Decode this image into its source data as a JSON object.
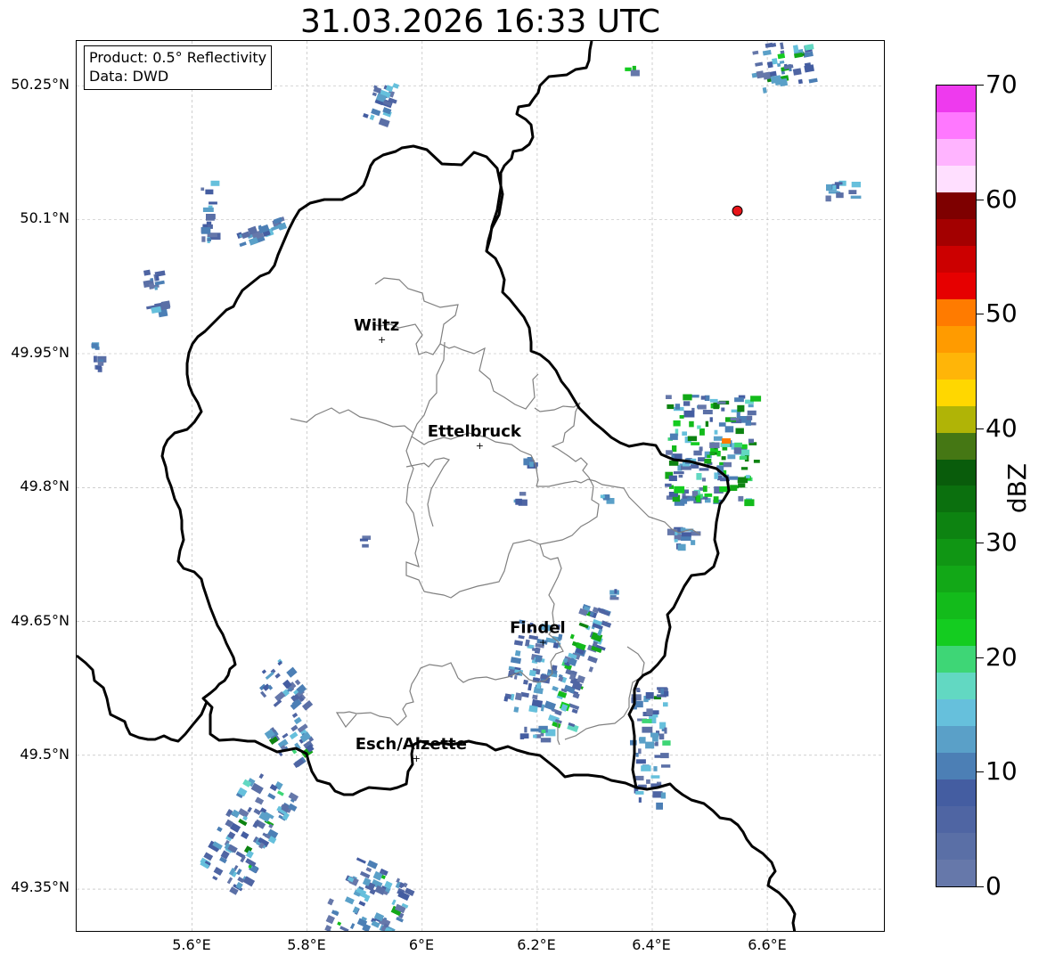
{
  "title": "31.03.2026 16:33 UTC",
  "info": {
    "product": "Product: 0.5° Reflectivity",
    "data": "Data: DWD"
  },
  "axes": {
    "lat_ticks": [
      "50.25°N",
      "50.1°N",
      "49.95°N",
      "49.8°N",
      "49.65°N",
      "49.5°N",
      "49.35°N"
    ],
    "lon_ticks": [
      "5.6°E",
      "5.8°E",
      "6°E",
      "6.2°E",
      "6.4°E",
      "6.6°E"
    ]
  },
  "cities": [
    {
      "name": "Wiltz",
      "lon": 5.93,
      "lat": 49.966
    },
    {
      "name": "Ettelbruck",
      "lon": 6.1,
      "lat": 49.847
    },
    {
      "name": "Findel",
      "lon": 6.21,
      "lat": 49.627
    },
    {
      "name": "Esch/Alzette",
      "lon": 5.99,
      "lat": 49.497
    }
  ],
  "radar_site": {
    "lon": 6.548,
    "lat": 50.11,
    "color": "#e8151a"
  },
  "colorbar": {
    "label": "dBZ",
    "tick_labels": [
      "0",
      "10",
      "20",
      "30",
      "40",
      "50",
      "60",
      "70"
    ],
    "colors": [
      "#6678aa",
      "#5a6fa6",
      "#4f65a3",
      "#445da1",
      "#4c7fb5",
      "#5aa0c8",
      "#66c0dc",
      "#62d8c2",
      "#3ed676",
      "#14cc20",
      "#13bb1b",
      "#12a817",
      "#109614",
      "#0d8311",
      "#0b700e",
      "#095c0b",
      "#457714",
      "#b0b406",
      "#ffd700",
      "#ffb508",
      "#ff9b00",
      "#ff7b00",
      "#e60000",
      "#cc0000",
      "#a30000",
      "#7e0000",
      "#ffdfff",
      "#ffb4ff",
      "#ff78ff",
      "#ee3aee"
    ]
  },
  "colors": {
    "border_country": "#000000",
    "border_canton": "#808080",
    "grid": "#b0b0b0"
  }
}
